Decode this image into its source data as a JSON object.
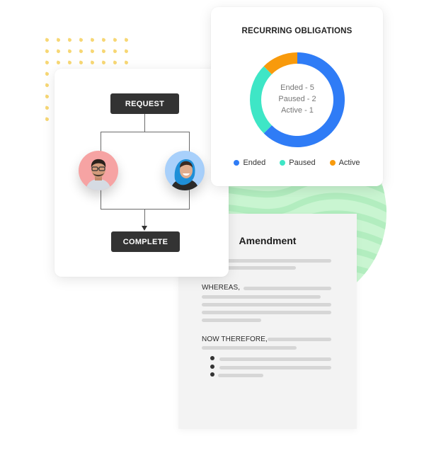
{
  "flowchart": {
    "request_label": "REQUEST",
    "complete_label": "COMPLETE",
    "avatars": [
      {
        "name": "reviewer-man",
        "bg": "#f6a3a3"
      },
      {
        "name": "reviewer-woman",
        "bg": "#a8d0fb"
      }
    ]
  },
  "recurring": {
    "title": "RECURRING OBLIGATIONS",
    "center_lines": [
      "Ended - 5",
      "Paused - 2",
      "Active - 1"
    ],
    "legend": [
      {
        "label": "Ended",
        "color": "#2f7cf6"
      },
      {
        "label": "Paused",
        "color": "#3ee6c6"
      },
      {
        "label": "Active",
        "color": "#f89a0c"
      }
    ]
  },
  "chart_data": {
    "type": "pie",
    "title": "RECURRING OBLIGATIONS",
    "categories": [
      "Ended",
      "Paused",
      "Active"
    ],
    "values": [
      5,
      2,
      1
    ],
    "colors": [
      "#2f7cf6",
      "#3ee6c6",
      "#f89a0c"
    ],
    "legend": "bottom",
    "donut": true
  },
  "document": {
    "title": "Amendment",
    "whereas_label": "WHEREAS,",
    "now_therefore_label": "NOW THEREFORE,"
  },
  "colors": {
    "accent_green": "#c9f5d1",
    "dots_yellow": "#f7d774",
    "button_dark": "#333333"
  }
}
